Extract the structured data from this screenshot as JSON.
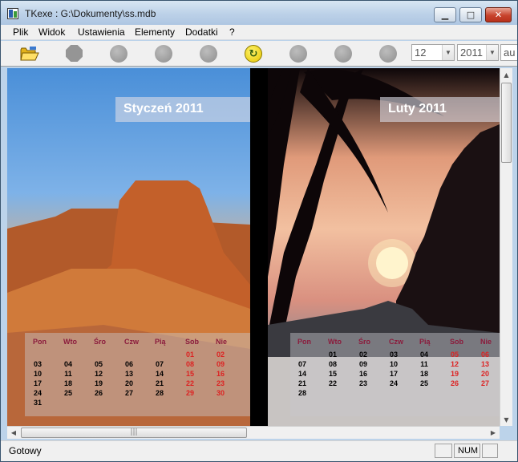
{
  "window": {
    "title": "TKexe : G:\\Dokumenty\\ss.mdb"
  },
  "menu": {
    "items": [
      "Plik",
      "Widok",
      "Ustawienia",
      "Elementy",
      "Dodatki",
      "?"
    ]
  },
  "toolbar": {
    "month_value": "12",
    "year_value": "2011",
    "extra_value": "au"
  },
  "calendar": {
    "weekday_headers": [
      "Pon",
      "Wto",
      "Śro",
      "Czw",
      "Pią",
      "Sob",
      "Nie"
    ],
    "pages": [
      {
        "title": "Styczeń 2011",
        "weeks": [
          [
            "",
            "",
            "",
            "",
            "",
            "01",
            "02"
          ],
          [
            "03",
            "04",
            "05",
            "06",
            "07",
            "08",
            "09"
          ],
          [
            "10",
            "11",
            "12",
            "13",
            "14",
            "15",
            "16"
          ],
          [
            "17",
            "18",
            "19",
            "20",
            "21",
            "22",
            "23"
          ],
          [
            "24",
            "25",
            "26",
            "27",
            "28",
            "29",
            "30"
          ],
          [
            "31",
            "",
            "",
            "",
            "",
            "",
            ""
          ]
        ]
      },
      {
        "title": "Luty 2011",
        "weeks": [
          [
            "",
            "01",
            "02",
            "03",
            "04",
            "05",
            "06"
          ],
          [
            "07",
            "08",
            "09",
            "10",
            "11",
            "12",
            "13"
          ],
          [
            "14",
            "15",
            "16",
            "17",
            "18",
            "19",
            "20"
          ],
          [
            "21",
            "22",
            "23",
            "24",
            "25",
            "26",
            "27"
          ],
          [
            "28",
            "",
            "",
            "",
            "",
            "",
            ""
          ]
        ]
      }
    ]
  },
  "status": {
    "text": "Gotowy",
    "num": "NUM"
  }
}
